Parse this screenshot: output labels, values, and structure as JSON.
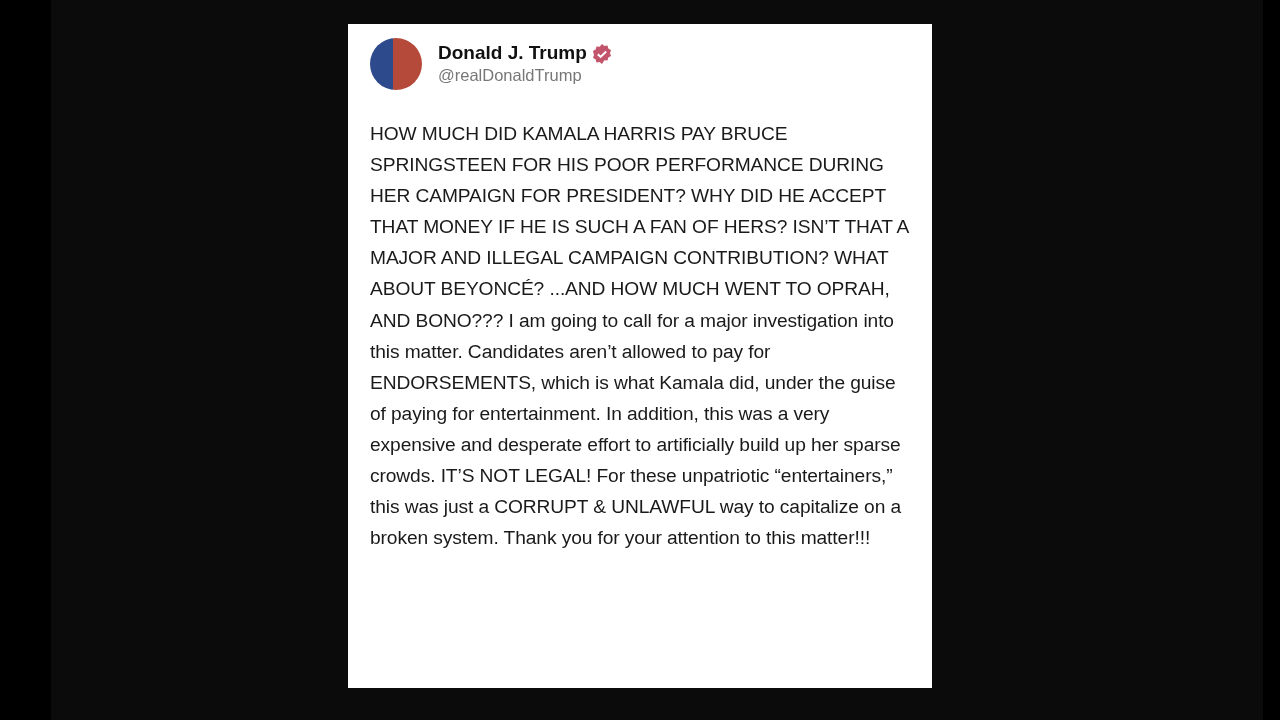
{
  "post": {
    "author": {
      "name": "Donald J. Trump",
      "handle": "@realDonaldTrump",
      "verified": true
    },
    "text": "HOW MUCH DID KAMALA HARRIS PAY BRUCE SPRINGSTEEN FOR HIS POOR PERFORMANCE DURING HER CAMPAIGN FOR PRESIDENT? WHY DID HE ACCEPT THAT MONEY IF HE IS SUCH A FAN OF HERS? ISN’T THAT A MAJOR AND ILLEGAL CAMPAIGN CONTRIBUTION? WHAT ABOUT BEYONCÉ? ...AND HOW MUCH WENT TO OPRAH, AND BONO??? I am going to call for a major investigation into this matter. Candidates aren’t allowed to pay for ENDORSEMENTS, which is what Kamala did, under the guise of paying for entertainment. In addition, this was a very expensive and desperate effort to artificially build up her sparse crowds. IT’S NOT LEGAL! For these unpatriotic “entertainers,” this was just a CORRUPT & UNLAWFUL way to capitalize on a broken system. Thank you for your attention to this matter!!!"
  }
}
